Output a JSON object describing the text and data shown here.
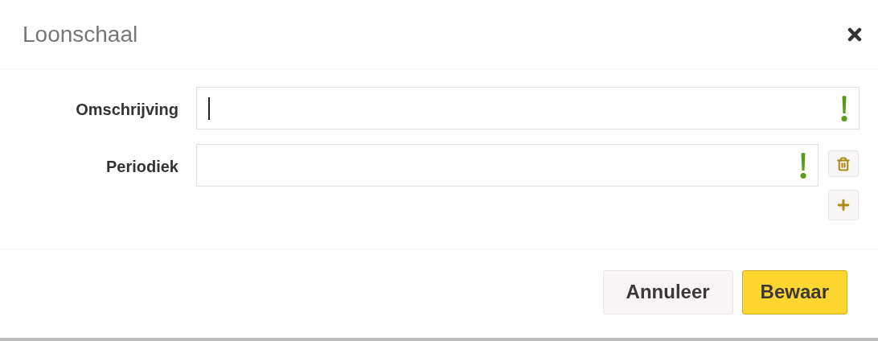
{
  "dialog": {
    "title": "Loonschaal"
  },
  "fields": [
    {
      "label": "Omschrijving",
      "focused": true,
      "required": true,
      "removable": false
    },
    {
      "label": "Periodiek",
      "focused": false,
      "required": true,
      "removable": true
    }
  ],
  "buttons": [
    {
      "label": "Annuleer",
      "kind": "secondary"
    },
    {
      "label": "Bewaar",
      "kind": "primary"
    }
  ]
}
